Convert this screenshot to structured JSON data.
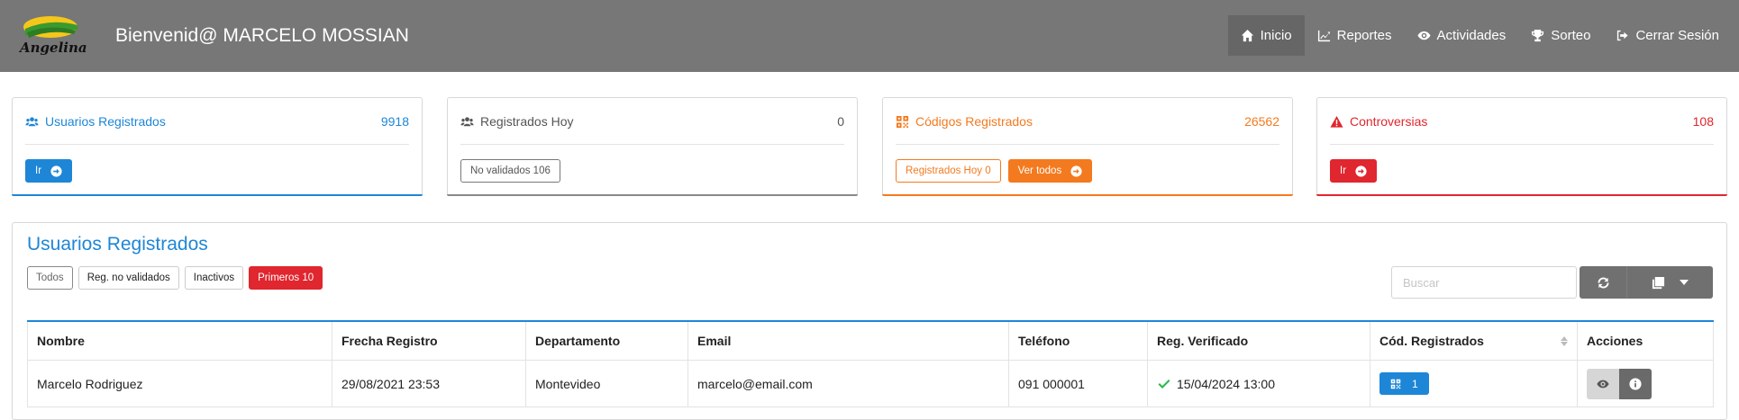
{
  "header": {
    "logo_text": "Angelina",
    "welcome": "Bienvenid@ MARCELO MOSSIAN",
    "nav": [
      {
        "label": "Inicio",
        "icon": "home-icon",
        "active": true
      },
      {
        "label": "Reportes",
        "icon": "chart-line-icon",
        "active": false
      },
      {
        "label": "Actividades",
        "icon": "eye-icon",
        "active": false
      },
      {
        "label": "Sorteo",
        "icon": "trophy-icon",
        "active": false
      },
      {
        "label": "Cerrar Sesión",
        "icon": "sign-out-icon",
        "active": false
      }
    ]
  },
  "cards": {
    "usuarios": {
      "title": "Usuarios Registrados",
      "count": "9918",
      "button": "Ir",
      "color": "#1e86d6"
    },
    "hoy": {
      "title": "Registrados Hoy",
      "count": "0",
      "button": "No validados 106",
      "color": "#666666"
    },
    "codigos": {
      "title": "Códigos Registrados",
      "count": "26562",
      "button_hoy": "Registrados Hoy 0",
      "button_todos": "Ver todos",
      "color": "#f47a1f"
    },
    "controversias": {
      "title": "Controversias",
      "count": "108",
      "button": "Ir",
      "color": "#e0262e"
    }
  },
  "panel": {
    "title": "Usuarios Registrados",
    "filters": [
      "Todos",
      "Reg. no validados",
      "Inactivos",
      "Primeros 10"
    ],
    "search_placeholder": "Buscar"
  },
  "table": {
    "headers": [
      "Nombre",
      "Frecha Registro",
      "Departamento",
      "Email",
      "Teléfono",
      "Reg. Verificado",
      "Cód. Registrados",
      "Acciones"
    ],
    "rows": [
      {
        "nombre": "Marcelo Rodriguez",
        "fecha": "29/08/2021 23:53",
        "departamento": "Montevideo",
        "email": "marcelo@email.com",
        "telefono": "091 000001",
        "verificado": "15/04/2024 13:00",
        "codigos": "1"
      }
    ]
  },
  "colors": {
    "header_bg": "#777777",
    "blue": "#1e86d6",
    "orange": "#f47a1f",
    "red": "#e0262e",
    "green": "#2db84d"
  }
}
